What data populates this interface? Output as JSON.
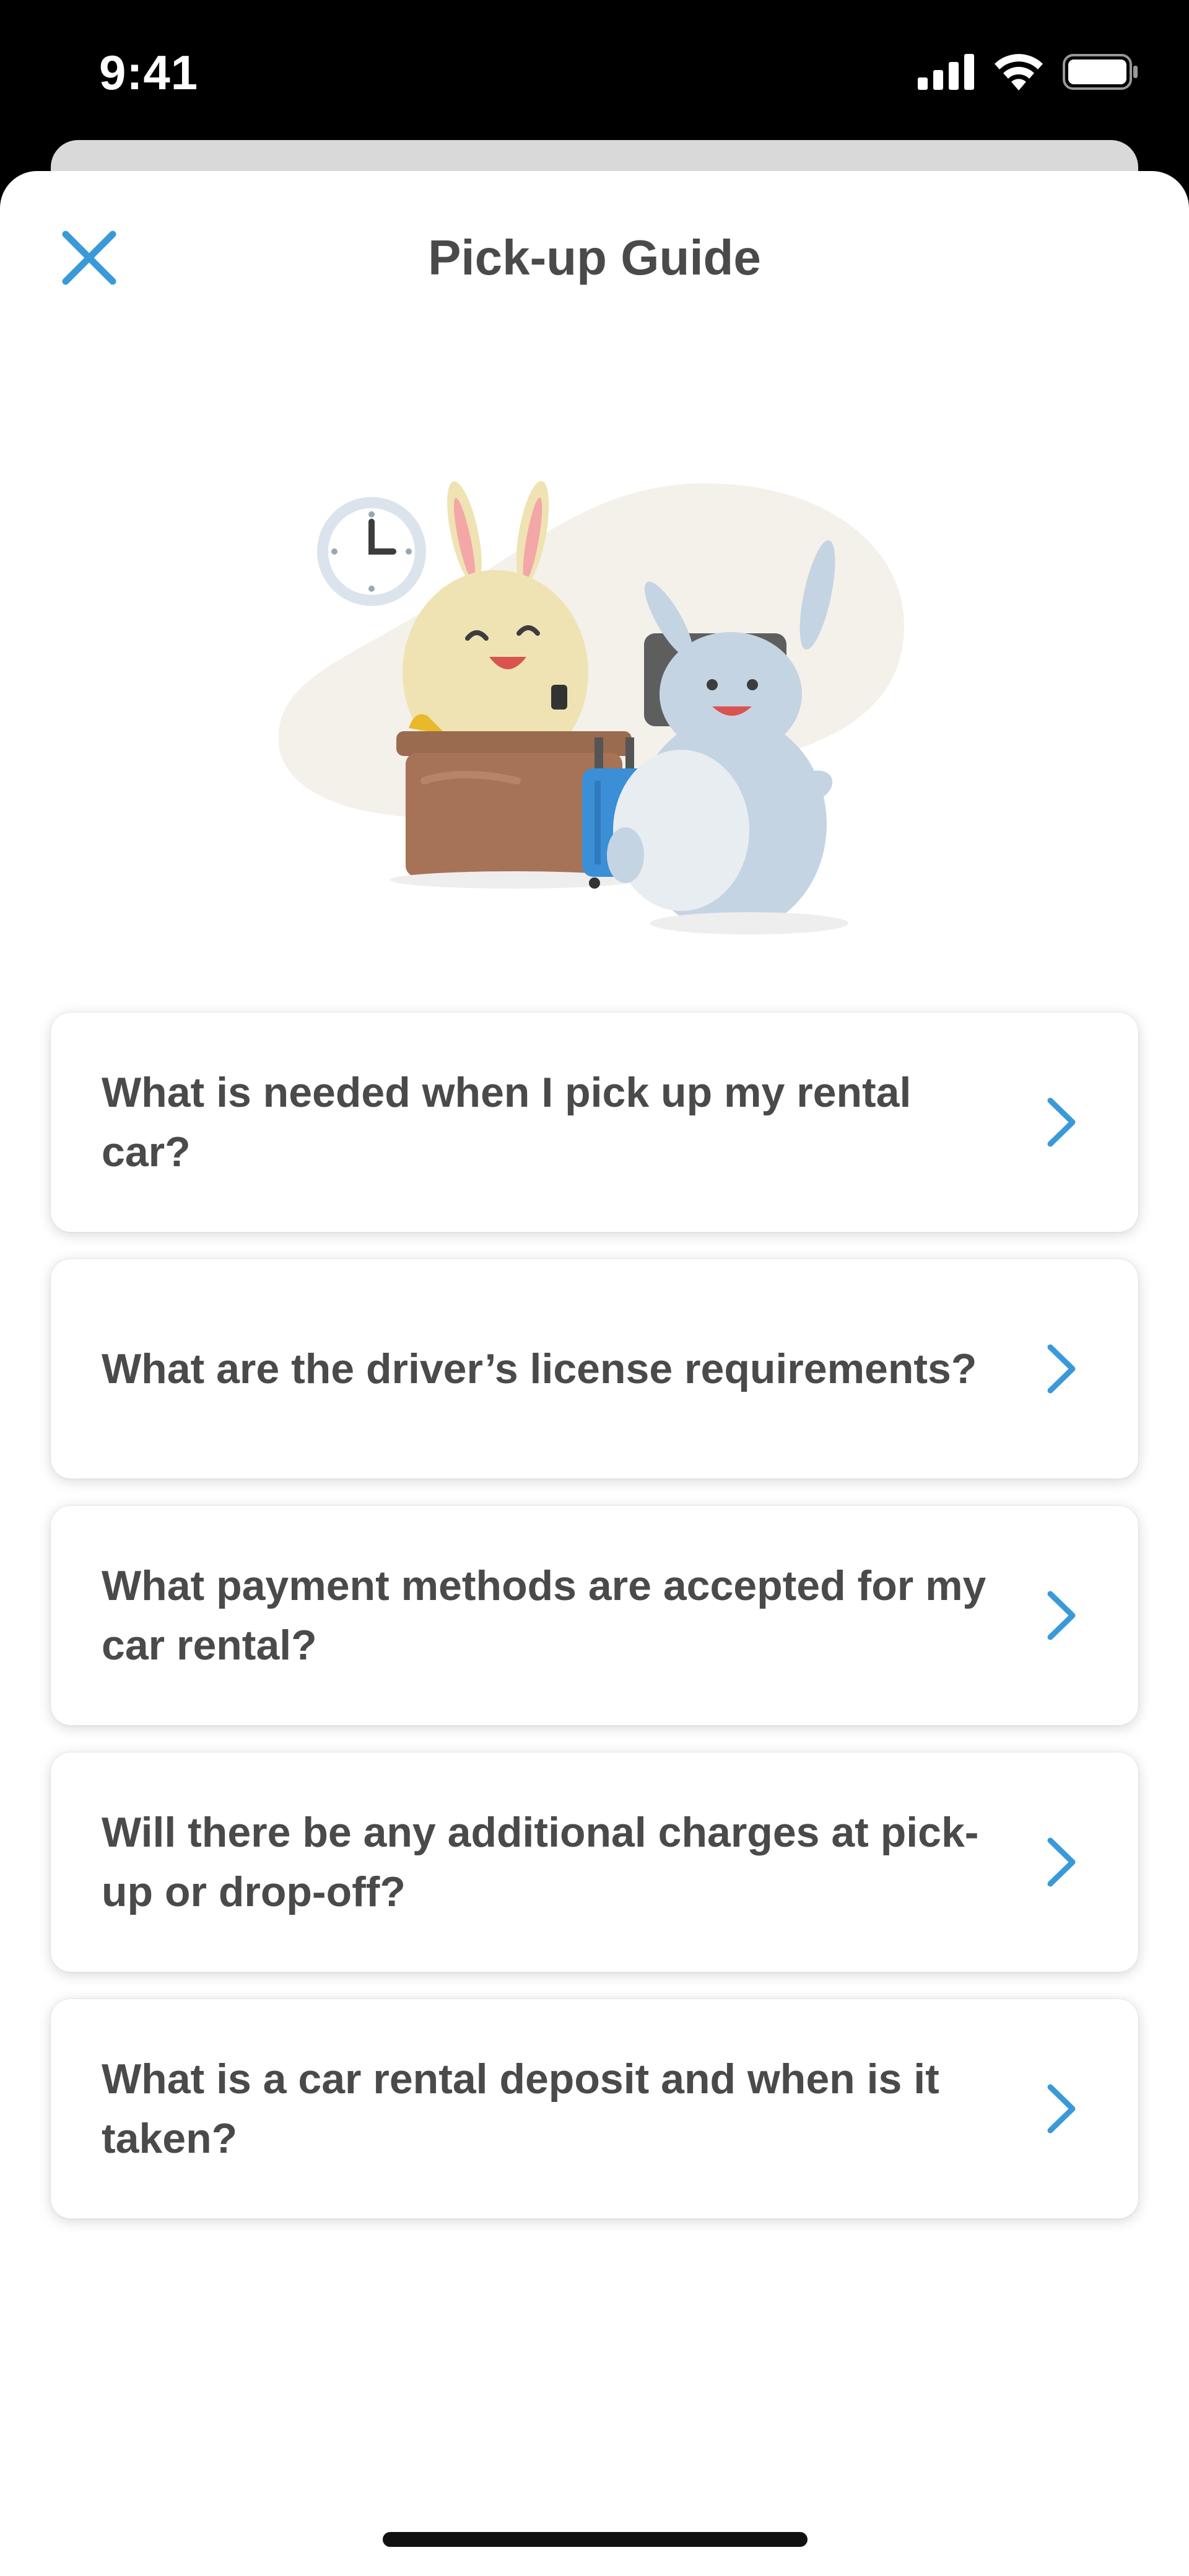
{
  "status_bar": {
    "time": "9:41"
  },
  "header": {
    "title": "Pick-up Guide",
    "close_icon": "close-icon",
    "accent_color": "#3a9ad9"
  },
  "faq": {
    "items": [
      {
        "question": "What is needed when I pick up my rental car?"
      },
      {
        "question": "What are the driver’s license requirements?"
      },
      {
        "question": "What payment methods are accepted for my car rental?"
      },
      {
        "question": "Will there be any additional charges at pick-up or drop-off?"
      },
      {
        "question": "What is a car rental deposit and when is it taken?"
      }
    ],
    "chevron_icon": "chevron-right-icon"
  }
}
